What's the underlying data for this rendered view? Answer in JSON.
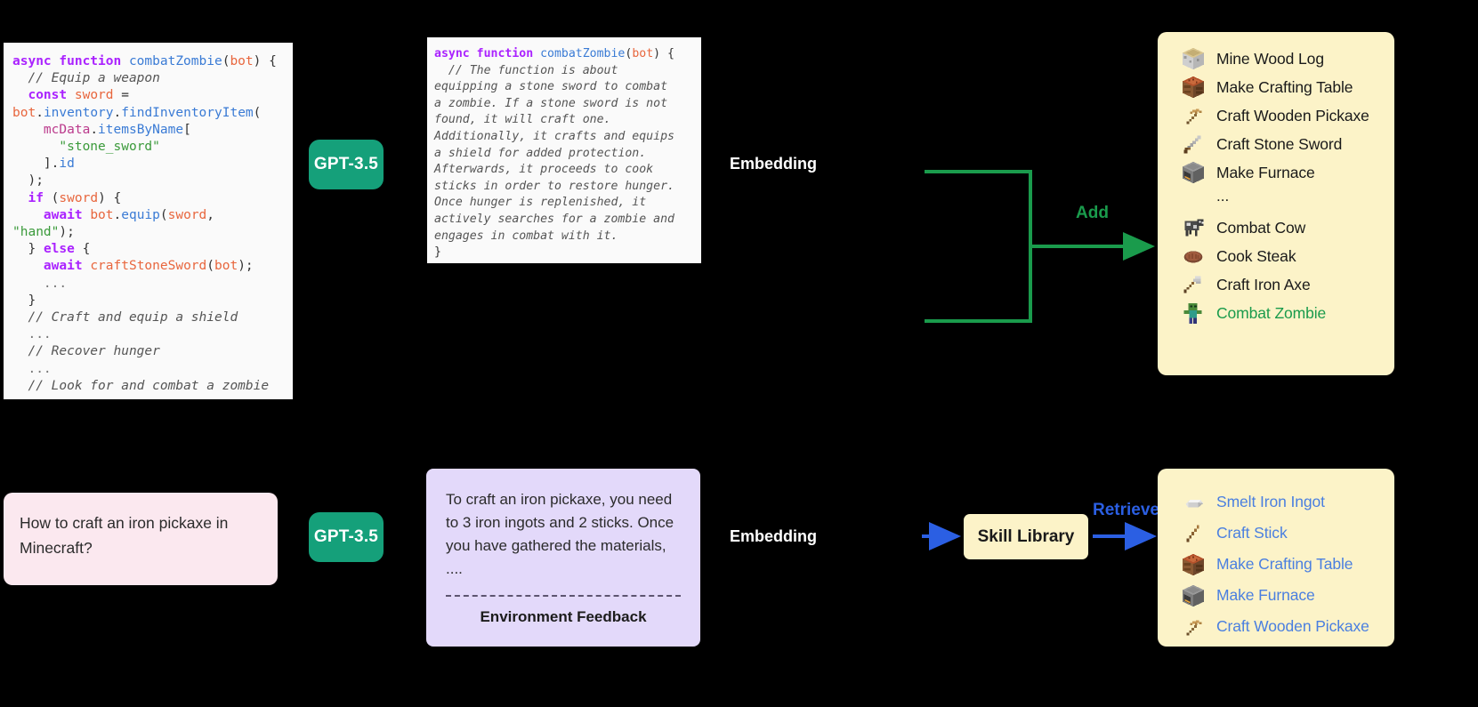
{
  "code_panel": {
    "name": "generated-skill-code",
    "lines": [
      [
        {
          "t": "kw",
          "s": "async function "
        },
        {
          "t": "fn",
          "s": "combatZombie"
        },
        {
          "t": "pln",
          "s": "("
        },
        {
          "t": "var",
          "s": "bot"
        },
        {
          "t": "pln",
          "s": ") {"
        }
      ],
      [
        {
          "t": "pln",
          "s": "  "
        },
        {
          "t": "cmt",
          "s": "// Equip a weapon"
        }
      ],
      [
        {
          "t": "pln",
          "s": "  "
        },
        {
          "t": "kw",
          "s": "const "
        },
        {
          "t": "var",
          "s": "sword"
        },
        {
          "t": "pln",
          "s": " ="
        }
      ],
      [
        {
          "t": "var",
          "s": "bot"
        },
        {
          "t": "pln",
          "s": "."
        },
        {
          "t": "fn",
          "s": "inventory"
        },
        {
          "t": "pln",
          "s": "."
        },
        {
          "t": "fn",
          "s": "findInventoryItem"
        },
        {
          "t": "pln",
          "s": "("
        }
      ],
      [
        {
          "t": "pln",
          "s": "    "
        },
        {
          "t": "prop",
          "s": "mcData"
        },
        {
          "t": "pln",
          "s": "."
        },
        {
          "t": "fn",
          "s": "itemsByName"
        },
        {
          "t": "pln",
          "s": "["
        }
      ],
      [
        {
          "t": "pln",
          "s": "      "
        },
        {
          "t": "str",
          "s": "\"stone_sword\""
        }
      ],
      [
        {
          "t": "pln",
          "s": "    ]."
        },
        {
          "t": "fn",
          "s": "id"
        }
      ],
      [
        {
          "t": "pln",
          "s": "  );"
        }
      ],
      [
        {
          "t": "pln",
          "s": "  "
        },
        {
          "t": "kw",
          "s": "if"
        },
        {
          "t": "pln",
          "s": " ("
        },
        {
          "t": "var",
          "s": "sword"
        },
        {
          "t": "pln",
          "s": ") {"
        }
      ],
      [
        {
          "t": "pln",
          "s": "    "
        },
        {
          "t": "kw",
          "s": "await "
        },
        {
          "t": "var",
          "s": "bot"
        },
        {
          "t": "pln",
          "s": "."
        },
        {
          "t": "fn",
          "s": "equip"
        },
        {
          "t": "pln",
          "s": "("
        },
        {
          "t": "var",
          "s": "sword"
        },
        {
          "t": "pln",
          "s": ", "
        },
        {
          "t": "str",
          "s": "\"hand\""
        },
        {
          "t": "pln",
          "s": ");"
        }
      ],
      [
        {
          "t": "pln",
          "s": "  } "
        },
        {
          "t": "kw",
          "s": "else"
        },
        {
          "t": "pln",
          "s": " {"
        }
      ],
      [
        {
          "t": "pln",
          "s": "    "
        },
        {
          "t": "kw",
          "s": "await "
        },
        {
          "t": "var",
          "s": "craftStoneSword"
        },
        {
          "t": "pln",
          "s": "("
        },
        {
          "t": "var",
          "s": "bot"
        },
        {
          "t": "pln",
          "s": ");"
        }
      ],
      [
        {
          "t": "pln",
          "s": "    "
        },
        {
          "t": "ell",
          "s": "..."
        }
      ],
      [
        {
          "t": "pln",
          "s": "  }"
        }
      ],
      [
        {
          "t": "pln",
          "s": "  "
        },
        {
          "t": "cmt",
          "s": "// Craft and equip a shield"
        }
      ],
      [
        {
          "t": "pln",
          "s": "  "
        },
        {
          "t": "ell",
          "s": "..."
        }
      ],
      [
        {
          "t": "pln",
          "s": "  "
        },
        {
          "t": "cmt",
          "s": "// Recover hunger"
        }
      ],
      [
        {
          "t": "pln",
          "s": "  "
        },
        {
          "t": "ell",
          "s": "..."
        }
      ],
      [
        {
          "t": "pln",
          "s": "  "
        },
        {
          "t": "cmt",
          "s": "// Look for and combat a zombie"
        }
      ],
      [
        {
          "t": "pln",
          "s": "  "
        },
        {
          "t": "ell",
          "s": "..."
        }
      ],
      [
        {
          "t": "pln",
          "s": "}"
        }
      ]
    ]
  },
  "description_panel": {
    "name": "skill-description",
    "signature_parts": [
      {
        "t": "kw",
        "s": "async function "
      },
      {
        "t": "fn",
        "s": "combatZombie"
      },
      {
        "t": "pln",
        "s": "("
      },
      {
        "t": "var",
        "s": "bot"
      },
      {
        "t": "pln",
        "s": ") {"
      }
    ],
    "comment": "  // The function is about\nequipping a stone sword to combat\na zombie. If a stone sword is not\nfound, it will craft one.\nAdditionally, it crafts and equips\na shield for added protection.\nAfterwards, it proceeds to cook\nsticks in order to restore hunger.\nOnce hunger is replenished, it\nactively searches for a zombie and\nengages in combat with it.",
    "closing_brace": "}"
  },
  "badges": {
    "gpt_top": "GPT-3.5",
    "gpt_bottom": "GPT-3.5"
  },
  "labels": {
    "embedding_top": "Embedding",
    "embedding_bottom": "Embedding",
    "add": "Add",
    "retrieve": "Retrieve",
    "skill_library": "Skill Library"
  },
  "question_bubble": {
    "text": "How to craft an iron pickaxe in Minecraft?"
  },
  "answer_bubble": {
    "text": "To craft an iron pickaxe, you need to 3 iron ingots and 2 sticks. Once you have gathered the materials, ....",
    "feedback_label": "Environment Feedback"
  },
  "skill_list_top": {
    "items": [
      {
        "icon": "log-block-icon",
        "label": "Mine Wood  Log",
        "style": "normal"
      },
      {
        "icon": "crafting-table-icon",
        "label": "Make Crafting Table",
        "style": "normal"
      },
      {
        "icon": "wooden-pickaxe-icon",
        "label": "Craft Wooden Pickaxe",
        "style": "normal"
      },
      {
        "icon": "stone-sword-icon",
        "label": "Craft Stone Sword",
        "style": "normal"
      },
      {
        "icon": "furnace-icon",
        "label": "Make Furnace",
        "style": "normal"
      },
      {
        "icon": "ellipsis-icon",
        "label": "...",
        "style": "ellipsis"
      },
      {
        "icon": "cow-icon",
        "label": "Combat Cow",
        "style": "normal"
      },
      {
        "icon": "steak-icon",
        "label": "Cook Steak",
        "style": "normal"
      },
      {
        "icon": "iron-axe-icon",
        "label": "Craft Iron Axe",
        "style": "normal"
      },
      {
        "icon": "zombie-icon",
        "label": "Combat Zombie",
        "style": "green"
      }
    ]
  },
  "skill_list_bottom": {
    "items": [
      {
        "icon": "iron-ingot-icon",
        "label": "Smelt Iron Ingot",
        "style": "blue"
      },
      {
        "icon": "stick-icon",
        "label": "Craft Stick",
        "style": "blue"
      },
      {
        "icon": "crafting-table-icon",
        "label": "Make Crafting Table",
        "style": "blue"
      },
      {
        "icon": "furnace-icon",
        "label": "Make Furnace",
        "style": "blue"
      },
      {
        "icon": "wooden-pickaxe-icon",
        "label": "Craft Wooden Pickaxe",
        "style": "blue"
      }
    ]
  },
  "colors": {
    "background": "#000000",
    "code_panel_bg": "#fafafa",
    "skill_panel_bg": "#fcf3c8",
    "question_bubble_bg": "#fbe8ef",
    "answer_bubble_bg": "#e3d9fa",
    "gpt_badge_bg": "#15a07a",
    "add_arrow": "#1a9b4c",
    "retrieve_arrow": "#2b5fe3"
  }
}
